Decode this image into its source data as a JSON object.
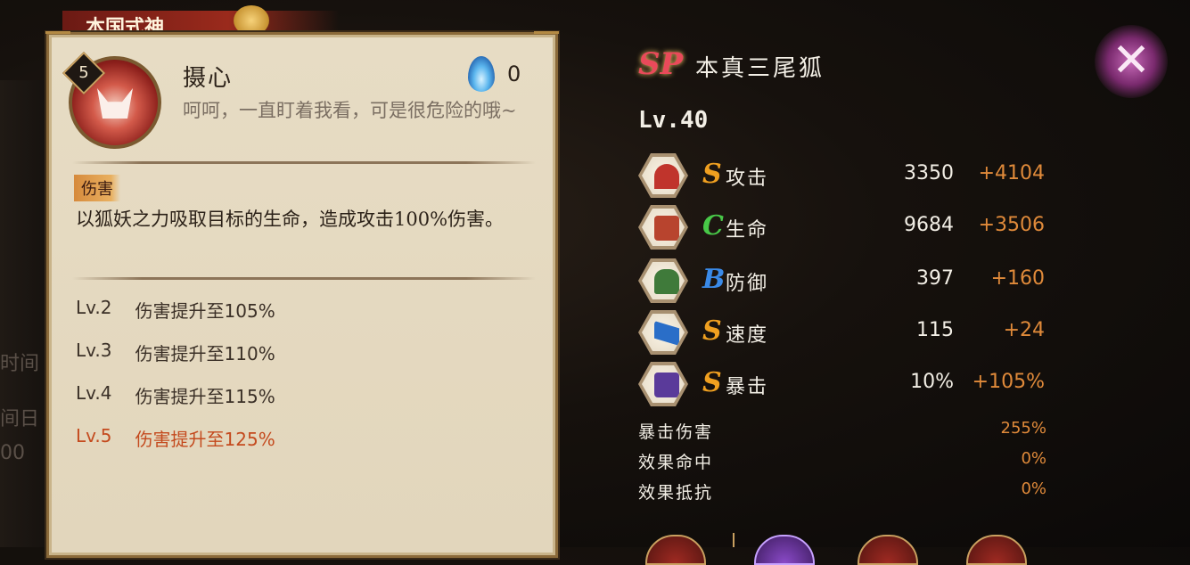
{
  "background_text": [
    "时间",
    "间日",
    "00"
  ],
  "skill_card": {
    "banner_title": "本国式神",
    "level": "5",
    "name": "摄心",
    "cost": "0",
    "quote": "呵呵，一直盯着我看，可是很危险的哦~",
    "tag": "伤害",
    "description": "以狐妖之力吸取目标的生命，造成攻击100%伤害。",
    "upgrades": [
      {
        "level": "Lv.2",
        "text": "伤害提升至105%",
        "highlight": false
      },
      {
        "level": "Lv.3",
        "text": "伤害提升至110%",
        "highlight": false
      },
      {
        "level": "Lv.4",
        "text": "伤害提升至115%",
        "highlight": false
      },
      {
        "level": "Lv.5",
        "text": "伤害提升至125%",
        "highlight": true
      }
    ]
  },
  "character": {
    "rarity": "SP",
    "name": "本真三尾狐",
    "level": "Lv.40"
  },
  "stats": [
    {
      "icon": "attack-fan-icon",
      "grade": "S",
      "grade_color": "#f0a020",
      "label": "攻击",
      "base": "3350",
      "bonus": "+4104"
    },
    {
      "icon": "health-scroll-icon",
      "grade": "C",
      "grade_color": "#48c848",
      "label": "生命",
      "base": "9684",
      "bonus": "+3506"
    },
    {
      "icon": "defense-armor-icon",
      "grade": "B",
      "grade_color": "#3a8ae8",
      "label": "防御",
      "base": "397",
      "bonus": "+160"
    },
    {
      "icon": "speed-arrow-icon",
      "grade": "S",
      "grade_color": "#f0a020",
      "label": "速度",
      "base": "115",
      "bonus": "+24"
    },
    {
      "icon": "crit-card-icon",
      "grade": "S",
      "grade_color": "#f0a020",
      "label": "暴击",
      "base": "10%",
      "bonus": "+105%"
    }
  ],
  "extra_stats": [
    {
      "label": "暴击伤害",
      "value": "255%"
    },
    {
      "label": "效果命中",
      "value": "0%"
    },
    {
      "label": "效果抵抗",
      "value": "0%"
    }
  ],
  "colors": {
    "card_bg": "#e4d9c0",
    "accent_orange": "#e08a3a",
    "highlight_red": "#c44a1e",
    "close_purple": "#7a2a6e"
  }
}
